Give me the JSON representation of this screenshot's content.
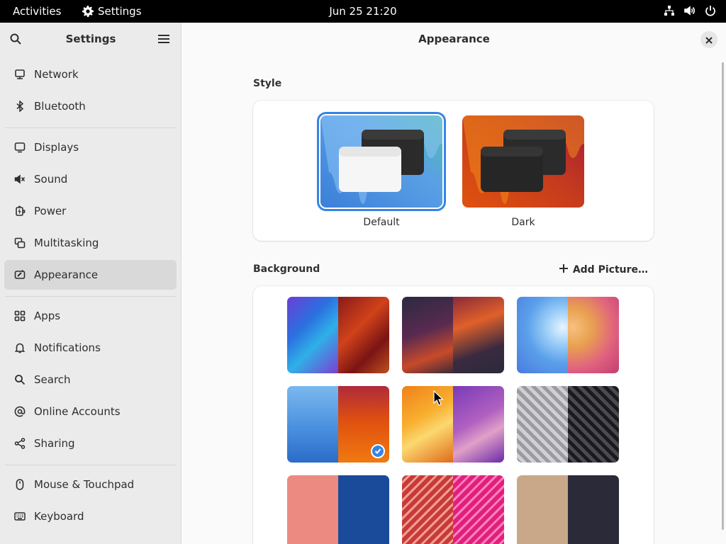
{
  "topbar": {
    "activities": "Activities",
    "app_name": "Settings",
    "clock": "Jun 25  21:20",
    "tray_icons": [
      "network-icon",
      "volume-icon",
      "power-icon"
    ]
  },
  "sidebar": {
    "title": "Settings",
    "items": [
      {
        "label": "Network",
        "icon": "network-icon"
      },
      {
        "label": "Bluetooth",
        "icon": "bluetooth-icon"
      },
      {
        "label": "Displays",
        "icon": "display-icon"
      },
      {
        "label": "Sound",
        "icon": "sound-icon"
      },
      {
        "label": "Power",
        "icon": "power-icon"
      },
      {
        "label": "Multitasking",
        "icon": "multitasking-icon"
      },
      {
        "label": "Appearance",
        "icon": "appearance-icon",
        "active": true
      },
      {
        "label": "Apps",
        "icon": "apps-icon"
      },
      {
        "label": "Notifications",
        "icon": "bell-icon"
      },
      {
        "label": "Search",
        "icon": "search-icon"
      },
      {
        "label": "Online Accounts",
        "icon": "at-icon"
      },
      {
        "label": "Sharing",
        "icon": "share-icon"
      },
      {
        "label": "Mouse & Touchpad",
        "icon": "mouse-icon"
      },
      {
        "label": "Keyboard",
        "icon": "keyboard-icon"
      }
    ]
  },
  "main": {
    "title": "Appearance",
    "style_label": "Style",
    "styles": [
      {
        "name": "Default",
        "selected": true
      },
      {
        "name": "Dark",
        "selected": false
      }
    ],
    "background_label": "Background",
    "add_picture": "Add Picture…",
    "wallpapers_selected_index": 3
  },
  "colors": {
    "accent": "#3584e4",
    "sidebar_bg": "#ebebeb",
    "sidebar_active": "#d9d9d9",
    "topbar_bg": "#000000"
  }
}
